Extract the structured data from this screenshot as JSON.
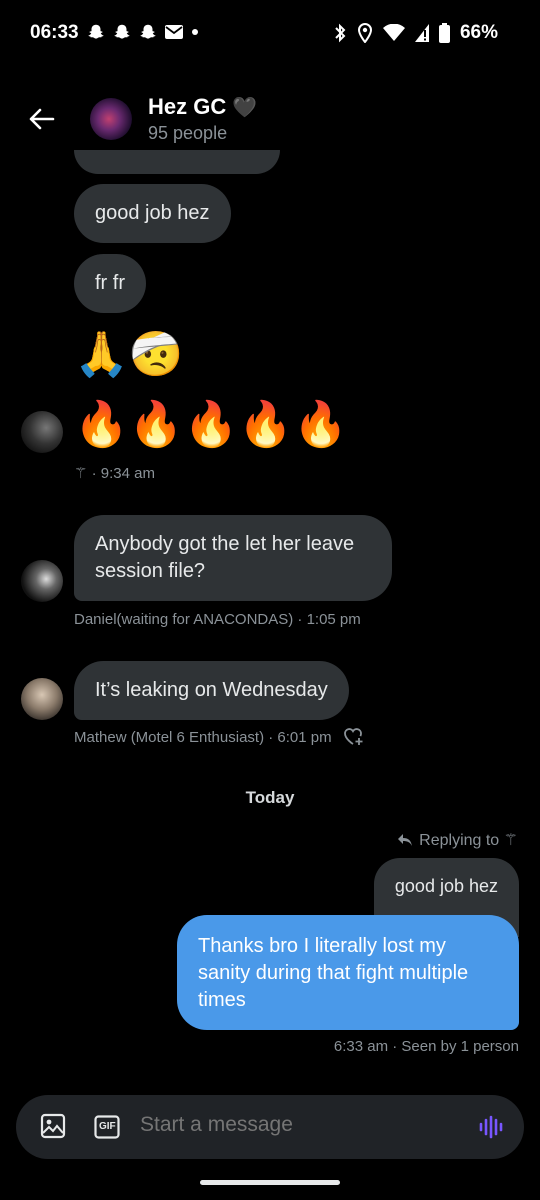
{
  "status_bar": {
    "time": "06:33",
    "battery": "66%",
    "left_icons": [
      "snapchat-icon",
      "snapchat-icon",
      "snapchat-icon",
      "mail-icon",
      "dot-icon"
    ],
    "right_icons": [
      "bluetooth-icon",
      "location-icon",
      "wifi-icon",
      "signal-icon",
      "battery-icon"
    ]
  },
  "header": {
    "title": "Hez GC",
    "title_emoji": "🖤",
    "subtitle": "95 people"
  },
  "messages": [
    {
      "text": "good job hez"
    },
    {
      "text": "fr fr"
    },
    {
      "emoji": "🙏🤕"
    },
    {
      "emoji": "🔥🔥🔥🔥🔥"
    },
    {
      "sender_meta_symbol": "⚚",
      "time": "· 9:34 am"
    },
    {
      "text": "Anybody got the let her leave session file?",
      "meta": "Daniel(waiting for ANACONDAS) · 1:05 pm"
    },
    {
      "text": "It’s leaking on Wednesday",
      "meta": "Mathew (Motel 6 Enthusiast) · 6:01 pm"
    }
  ],
  "divider": {
    "label": "Today"
  },
  "reply": {
    "label": "Replying to ⚚",
    "quoted_text": "good job hez"
  },
  "my_message": {
    "text": "Thanks bro I literally lost my sanity during that fight multiple times",
    "meta": "6:33 am · Seen by 1 person"
  },
  "composer": {
    "placeholder": "Start a message",
    "gif_label": "GIF"
  },
  "colors": {
    "background": "#000000",
    "bubble_other": "#2f3336",
    "bubble_mine": "#4a99e9",
    "muted": "#8b9298",
    "voice_accent": "#7856ff"
  }
}
